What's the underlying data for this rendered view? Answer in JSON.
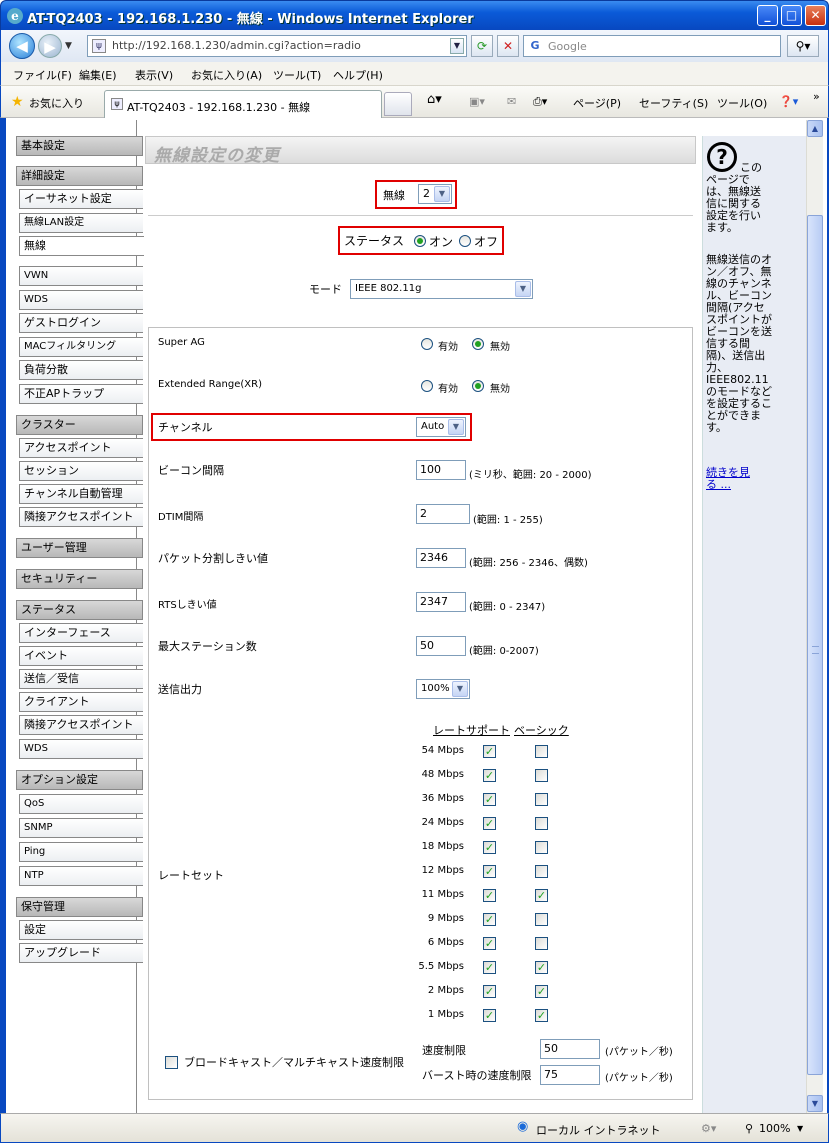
{
  "window": {
    "title": "AT-TQ2403 - 192.168.1.230 - 無線 - Windows Internet Explorer",
    "min": "_",
    "max": "□",
    "close": "✕"
  },
  "address": {
    "url": "http://192.168.1.230/admin.cgi?action=radio",
    "search_placeholder": "Google"
  },
  "menu": [
    "ファイル(F)",
    "編集(E)",
    "表示(V)",
    "お気に入り(A)",
    "ツール(T)",
    "ヘルプ(H)"
  ],
  "favorites": {
    "label": "お気に入り",
    "tab_title": "AT-TQ2403 - 192.168.1.230 - 無線",
    "commands": [
      "ページ(P)",
      "セーフティ(S)",
      "ツール(O)"
    ]
  },
  "nav": {
    "basic": "基本設定",
    "advanced": "詳細設定",
    "advanced_items": [
      "イーサネット設定",
      "無線LAN設定",
      "無線",
      "VWN",
      "WDS",
      "ゲストログイン",
      "MACフィルタリング",
      "負荷分散",
      "不正APトラップ"
    ],
    "cluster": "クラスター",
    "cluster_items": [
      "アクセスポイント",
      "セッション",
      "チャンネル自動管理",
      "隣接アクセスポイント"
    ],
    "user_mgmt": "ユーザー管理",
    "security": "セキュリティー",
    "status": "ステータス",
    "status_items": [
      "インターフェース",
      "イベント",
      "送信／受信",
      "クライアント",
      "隣接アクセスポイント",
      "WDS"
    ],
    "options": "オプション設定",
    "options_items": [
      "QoS",
      "SNMP",
      "Ping",
      "NTP"
    ],
    "maintenance": "保守管理",
    "maintenance_items": [
      "設定",
      "アップグレード"
    ]
  },
  "page": {
    "title": "無線設定の変更",
    "radio_label": "無線",
    "radio_value": "2",
    "status_label": "ステータス",
    "status_on": "オン",
    "status_off": "オフ",
    "mode_label": "モード",
    "mode_value": "IEEE 802.11g",
    "super_ag": "Super AG",
    "extended_range": "Extended Range(XR)",
    "enable": "有効",
    "disable": "無効",
    "channel_label": "チャンネル",
    "channel_value": "Auto",
    "beacon_label": "ビーコン間隔",
    "beacon_value": "100",
    "beacon_hint": "(ミリ秒、範囲: 20 - 2000)",
    "dtim_label": "DTIM間隔",
    "dtim_value": "2",
    "dtim_hint": "(範囲: 1 - 255)",
    "frag_label": "パケット分割しきい値",
    "frag_value": "2346",
    "frag_hint": "(範囲: 256 - 2346、偶数)",
    "rts_label": "RTSしきい値",
    "rts_value": "2347",
    "rts_hint": "(範囲: 0 - 2347)",
    "maxsta_label": "最大ステーション数",
    "maxsta_value": "50",
    "maxsta_hint": "(範囲: 0-2007)",
    "txpower_label": "送信出力",
    "txpower_value": "100%",
    "rate_header": "レート",
    "support_header": "サポート",
    "basic_header": "ベーシック",
    "rateset_label": "レートセット",
    "rates": [
      {
        "rate": "54 Mbps",
        "support": true,
        "basic": false
      },
      {
        "rate": "48 Mbps",
        "support": true,
        "basic": false
      },
      {
        "rate": "36 Mbps",
        "support": true,
        "basic": false
      },
      {
        "rate": "24 Mbps",
        "support": true,
        "basic": false
      },
      {
        "rate": "18 Mbps",
        "support": true,
        "basic": false
      },
      {
        "rate": "12 Mbps",
        "support": true,
        "basic": false
      },
      {
        "rate": "11 Mbps",
        "support": true,
        "basic": true
      },
      {
        "rate": "9 Mbps",
        "support": true,
        "basic": false
      },
      {
        "rate": "6 Mbps",
        "support": true,
        "basic": false
      },
      {
        "rate": "5.5 Mbps",
        "support": true,
        "basic": true
      },
      {
        "rate": "2 Mbps",
        "support": true,
        "basic": true
      },
      {
        "rate": "1 Mbps",
        "support": true,
        "basic": true
      }
    ],
    "broadcast_label": "ブロードキャスト／マルチキャスト速度制限",
    "rate_limit_label": "速度制限",
    "rate_limit_value": "50",
    "burst_label": "バースト時の速度制限",
    "burst_value": "75",
    "pps_unit": "(パケット／秒)"
  },
  "help": {
    "text1": "このページでは、無線送信に関する設定を行います。",
    "text2": "無線送信のオン／オフ、無線のチャンネル、ビーコン間隔(アクセスポイントがビーコンを送信する間隔)、送信出力、IEEE802.11のモードなどを設定することができます。",
    "link": "続きを見る ..."
  },
  "status_bar": {
    "zone": "ローカル イントラネット",
    "zoom": "100%"
  }
}
